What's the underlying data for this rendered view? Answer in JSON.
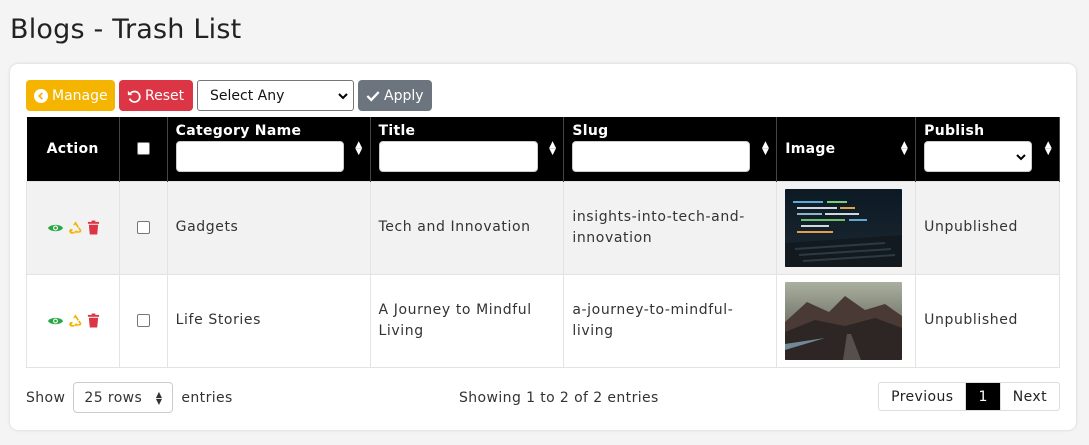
{
  "page": {
    "title": "Blogs - Trash List"
  },
  "toolbar": {
    "manage_label": "Manage",
    "reset_label": "Reset",
    "bulk_select_value": "Select Any",
    "apply_label": "Apply"
  },
  "table": {
    "columns": [
      {
        "label": "Action"
      },
      {
        "label": ""
      },
      {
        "label": "Category Name"
      },
      {
        "label": "Title"
      },
      {
        "label": "Slug"
      },
      {
        "label": "Image"
      },
      {
        "label": "Publish"
      }
    ],
    "rows": [
      {
        "category": "Gadgets",
        "title": "Tech and Innovation",
        "slug": "insights-into-tech-and-innovation",
        "image": "laptop-code-photo",
        "publish": "Unpublished"
      },
      {
        "category": "Life Stories",
        "title": "A Journey to Mindful Living",
        "slug": "a-journey-to-mindful-living",
        "image": "mountain-road-photo",
        "publish": "Unpublished"
      }
    ]
  },
  "footer": {
    "show_label": "Show",
    "rows_value": "25 rows",
    "entries_label": "entries",
    "info": "Showing 1 to 2 of 2 entries",
    "prev_label": "Previous",
    "page_label": "1",
    "next_label": "Next"
  },
  "colors": {
    "manage": "#f4b400",
    "reset": "#dc3545",
    "apply": "#6c757d",
    "view": "#28a745",
    "restore": "#f4b400",
    "delete": "#dc3545"
  }
}
